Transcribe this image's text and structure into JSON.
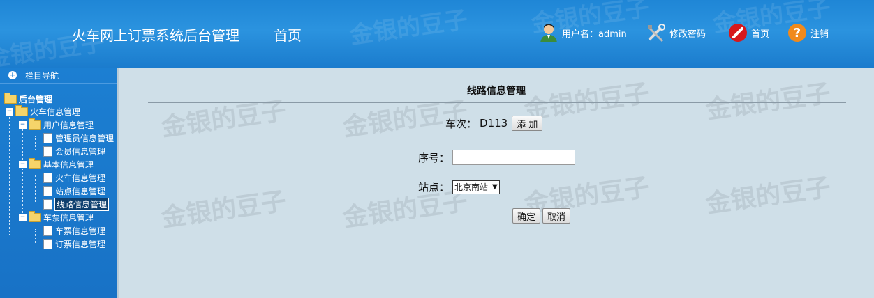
{
  "header": {
    "watermark": "金银的豆子",
    "app_title": "火车网上订票系统后台管理",
    "home_link": "首页",
    "user_label": "用户名：admin",
    "change_password": "修改密码",
    "home_button": "首页",
    "logout": "注销"
  },
  "sidebar": {
    "nav_title": "栏目导航",
    "root": "后台管理",
    "tree": [
      {
        "label": "火车信息管理"
      },
      {
        "label": "用户信息管理"
      },
      {
        "label": "管理员信息管理"
      },
      {
        "label": "会员信息管理"
      },
      {
        "label": "基本信息管理"
      },
      {
        "label": "火车信息管理"
      },
      {
        "label": "站点信息管理"
      },
      {
        "label": "线路信息管理",
        "selected": true
      },
      {
        "label": "车票信息管理"
      },
      {
        "label": "车票信息管理"
      },
      {
        "label": "订票信息管理"
      }
    ]
  },
  "main": {
    "watermark": "金银的豆子",
    "title": "线路信息管理",
    "train_label": "车次：",
    "train_value": "D113",
    "add_button": "添 加",
    "seq_label": "序号：",
    "seq_value": "",
    "station_label": "站点：",
    "station_selected": "北京南站",
    "confirm_button": "确定",
    "cancel_button": "取消"
  },
  "colors": {
    "header_blue": "#1f86d6",
    "sidebar_blue": "#1c7fd2",
    "content_bg": "#cfdfe8"
  }
}
